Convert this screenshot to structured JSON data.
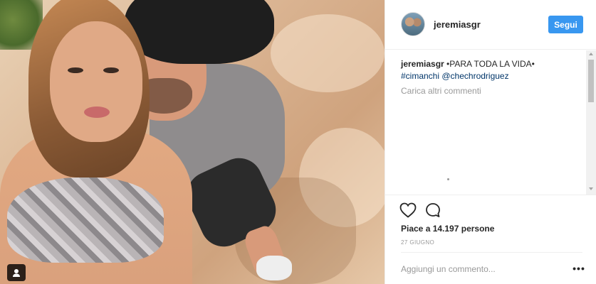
{
  "post": {
    "header": {
      "username": "jeremiasgr",
      "follow_label": "Segui"
    },
    "caption": {
      "username": "jeremiasgr",
      "text": "•PARA TODA LA VIDA•",
      "hashtag": "#cimanchi",
      "mention": "@chechrodriguez"
    },
    "load_more_label": "Carica altri commenti",
    "likes_text": "Piace a 14.197 persone",
    "date": "27 GIUGNO",
    "add_comment_placeholder": "Aggiungi un commento...",
    "more_label": "•••",
    "icons": {
      "like": "heart-icon",
      "comment": "comment-icon",
      "tag": "user-tag-icon"
    },
    "colors": {
      "follow_button": "#3897f0",
      "link": "#003569",
      "muted": "#999999"
    }
  }
}
